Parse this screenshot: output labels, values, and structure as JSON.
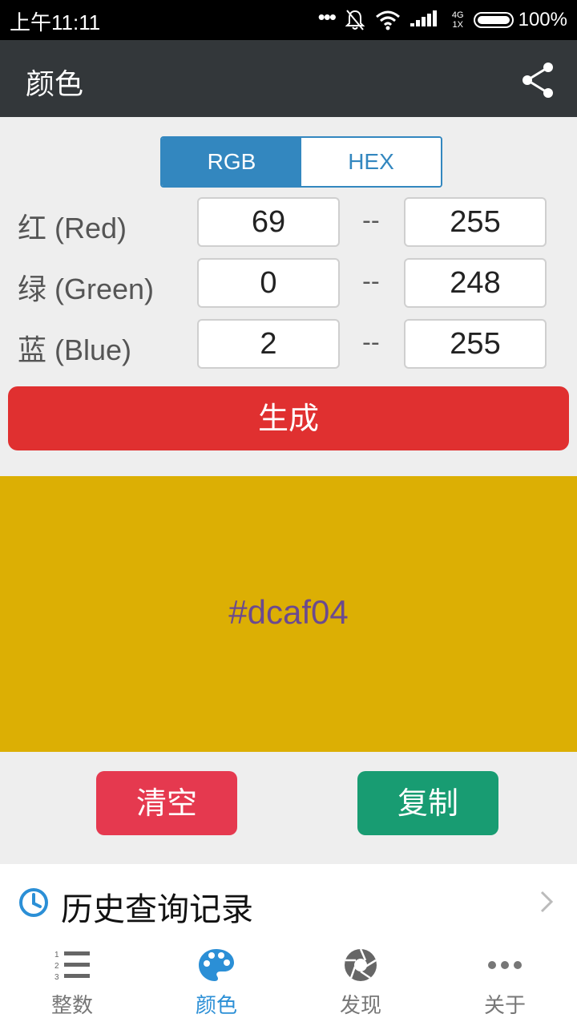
{
  "status_bar": {
    "time": "上午11:11",
    "dots": "•••",
    "network_top": "4G",
    "network_bottom": "1X",
    "battery": "100%",
    "battery_level": 1.0
  },
  "app_bar": {
    "title": "颜色"
  },
  "mode_tabs": [
    {
      "label": "RGB",
      "active": true
    },
    {
      "label": "HEX",
      "active": false
    }
  ],
  "ranges": {
    "separator": "--",
    "rows": [
      {
        "label": "红 (Red)",
        "min": "69",
        "max": "255"
      },
      {
        "label": "绿 (Green)",
        "min": "0",
        "max": "248"
      },
      {
        "label": "蓝 (Blue)",
        "min": "2",
        "max": "255"
      }
    ]
  },
  "generate_label": "生成",
  "result": {
    "hex": "#dcaf04",
    "color": "#dcaf04"
  },
  "actions": {
    "clear_label": "清空",
    "copy_label": "复制"
  },
  "history": {
    "label": "历史查询记录"
  },
  "bottom_nav": [
    {
      "label": "整数",
      "icon": "list-numbered-icon",
      "active": false
    },
    {
      "label": "颜色",
      "icon": "palette-icon",
      "active": true
    },
    {
      "label": "发现",
      "icon": "aperture-icon",
      "active": false
    },
    {
      "label": "关于",
      "icon": "more-dots-icon",
      "active": false
    }
  ],
  "colors": {
    "accent_blue": "#3387bf",
    "generate_red": "#e03030",
    "clear_red": "#e5394f",
    "copy_green": "#189c72",
    "nav_active": "#2b8fd6",
    "app_bar": "#33373a"
  }
}
